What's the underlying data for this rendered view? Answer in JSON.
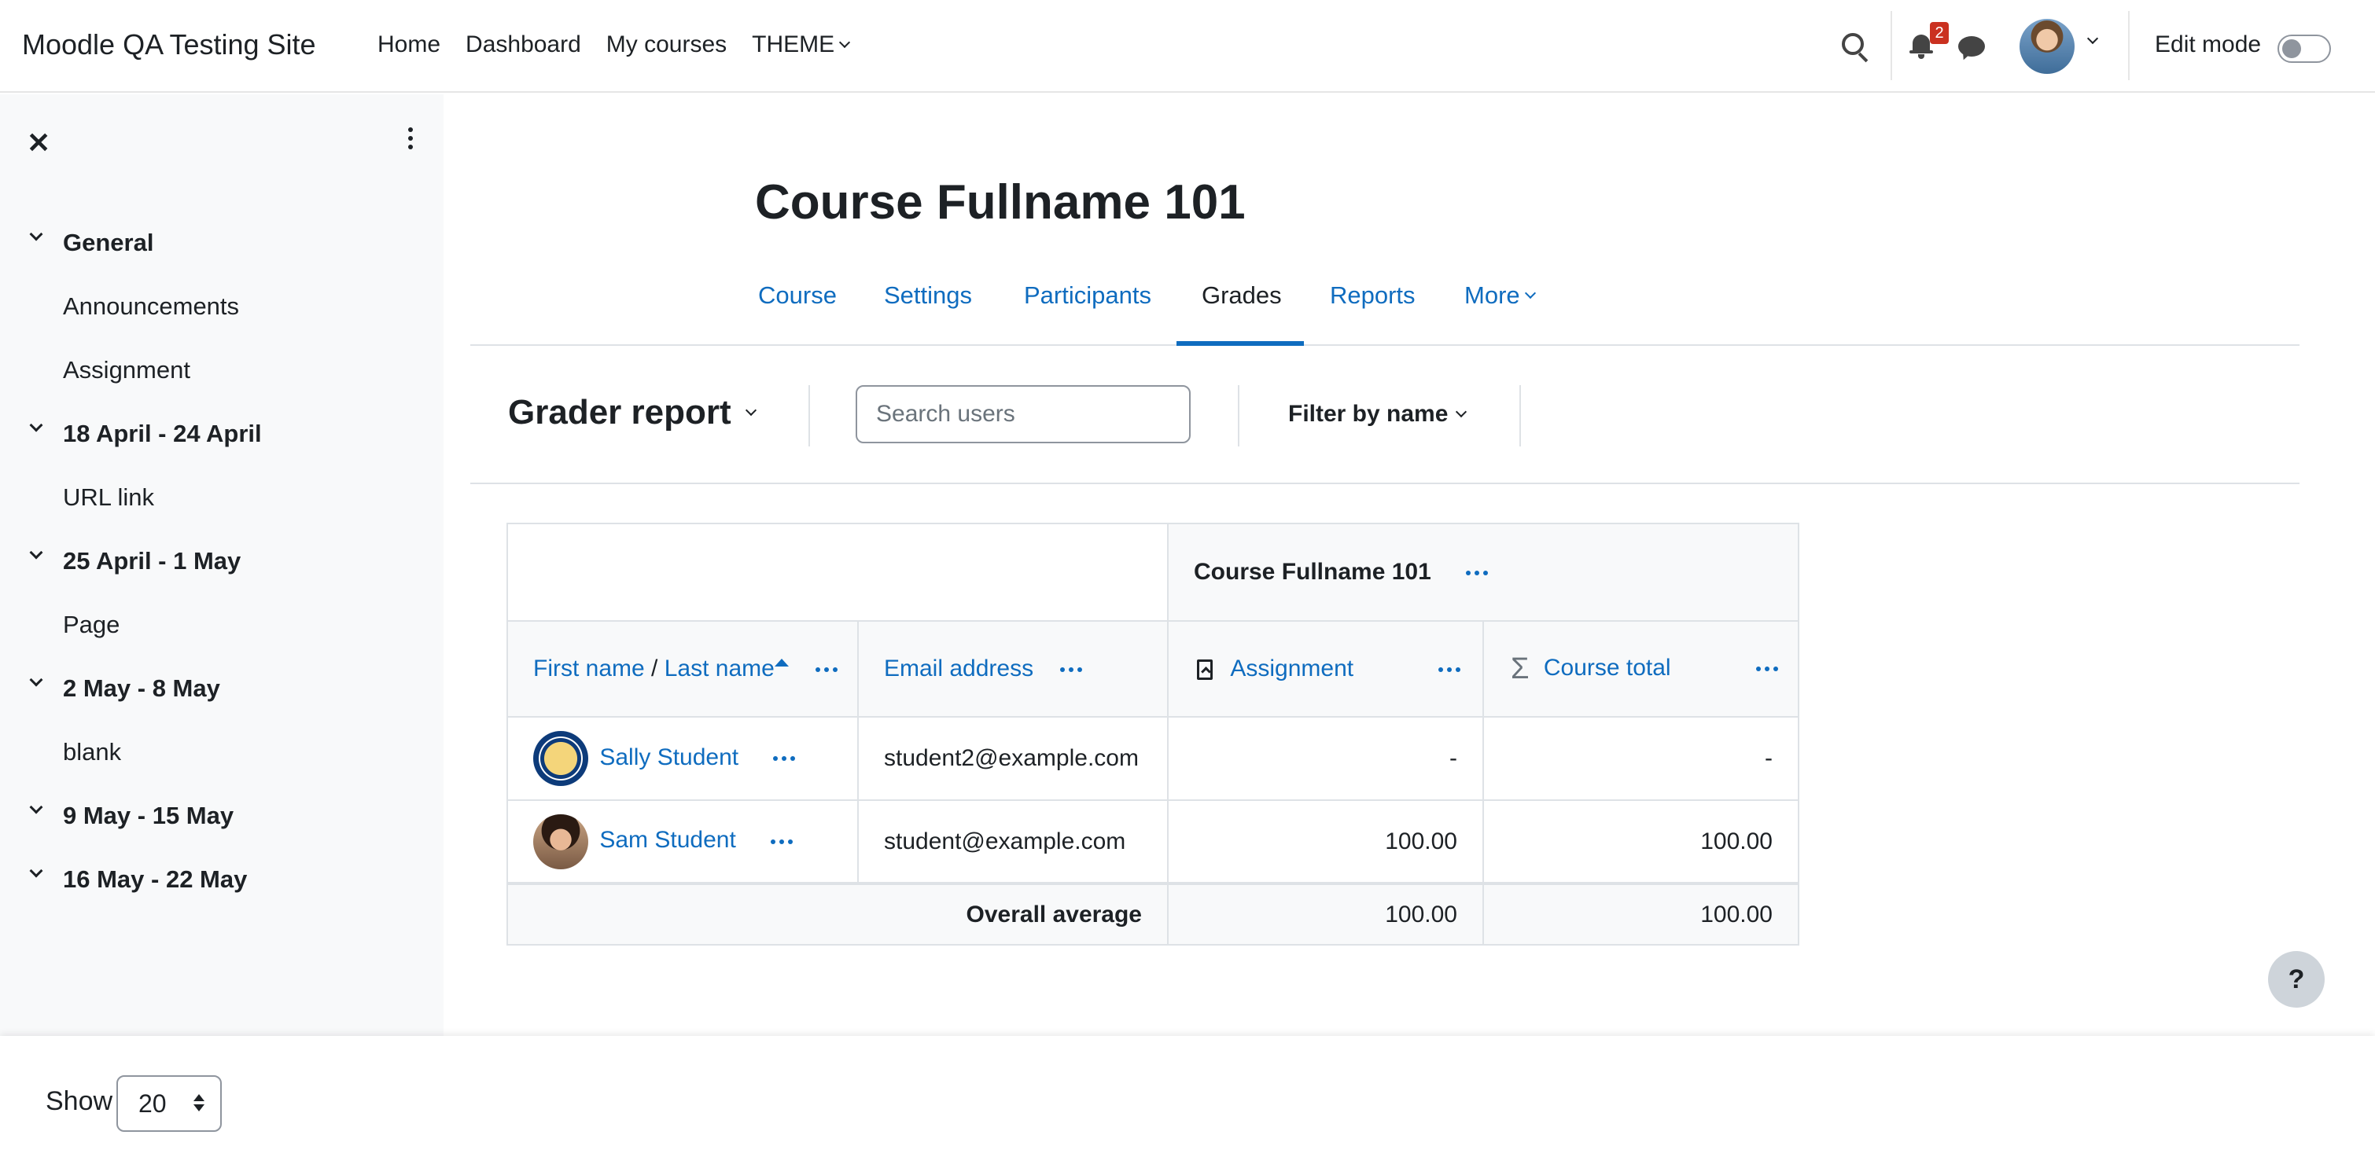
{
  "site": {
    "name": "Moodle QA Testing Site"
  },
  "primary_nav": [
    "Home",
    "Dashboard",
    "My courses",
    "THEME"
  ],
  "notifications": {
    "count": "2"
  },
  "edit_mode": {
    "label": "Edit mode",
    "on": false
  },
  "course_index": [
    {
      "type": "section",
      "label": "General"
    },
    {
      "type": "item",
      "label": "Announcements"
    },
    {
      "type": "item",
      "label": "Assignment"
    },
    {
      "type": "section",
      "label": "18 April - 24 April"
    },
    {
      "type": "item",
      "label": "URL link"
    },
    {
      "type": "section",
      "label": "25 April - 1 May"
    },
    {
      "type": "item",
      "label": "Page"
    },
    {
      "type": "section",
      "label": "2 May - 8 May"
    },
    {
      "type": "item",
      "label": "blank"
    },
    {
      "type": "section",
      "label": "9 May - 15 May"
    },
    {
      "type": "section",
      "label": "16 May - 22 May"
    }
  ],
  "page": {
    "title": "Course Fullname 101"
  },
  "secondary_nav": {
    "tabs": [
      "Course",
      "Settings",
      "Participants",
      "Grades",
      "Reports",
      "More"
    ],
    "active": "Grades"
  },
  "tertiary": {
    "report": "Grader report",
    "search_placeholder": "Search users",
    "filter_label": "Filter by name"
  },
  "grader": {
    "category_header": "Course Fullname 101",
    "columns": {
      "first_name": "First name",
      "separator": "/",
      "last_name": "Last name",
      "email": "Email address",
      "assignment": "Assignment",
      "course_total": "Course total"
    },
    "rows": [
      {
        "name": "Sally Student",
        "email": "student2@example.com",
        "assignment": "-",
        "total": "-"
      },
      {
        "name": "Sam Student",
        "email": "student@example.com",
        "assignment": "100.00",
        "total": "100.00"
      }
    ],
    "average": {
      "label": "Overall average",
      "assignment": "100.00",
      "total": "100.00"
    }
  },
  "footer": {
    "show_label": "Show",
    "per_page": "20"
  },
  "help": {
    "label": "?"
  },
  "colors": {
    "link": "#0f6cbf",
    "badge": "#ca3120",
    "drawer_bg": "#f8f9fa"
  }
}
